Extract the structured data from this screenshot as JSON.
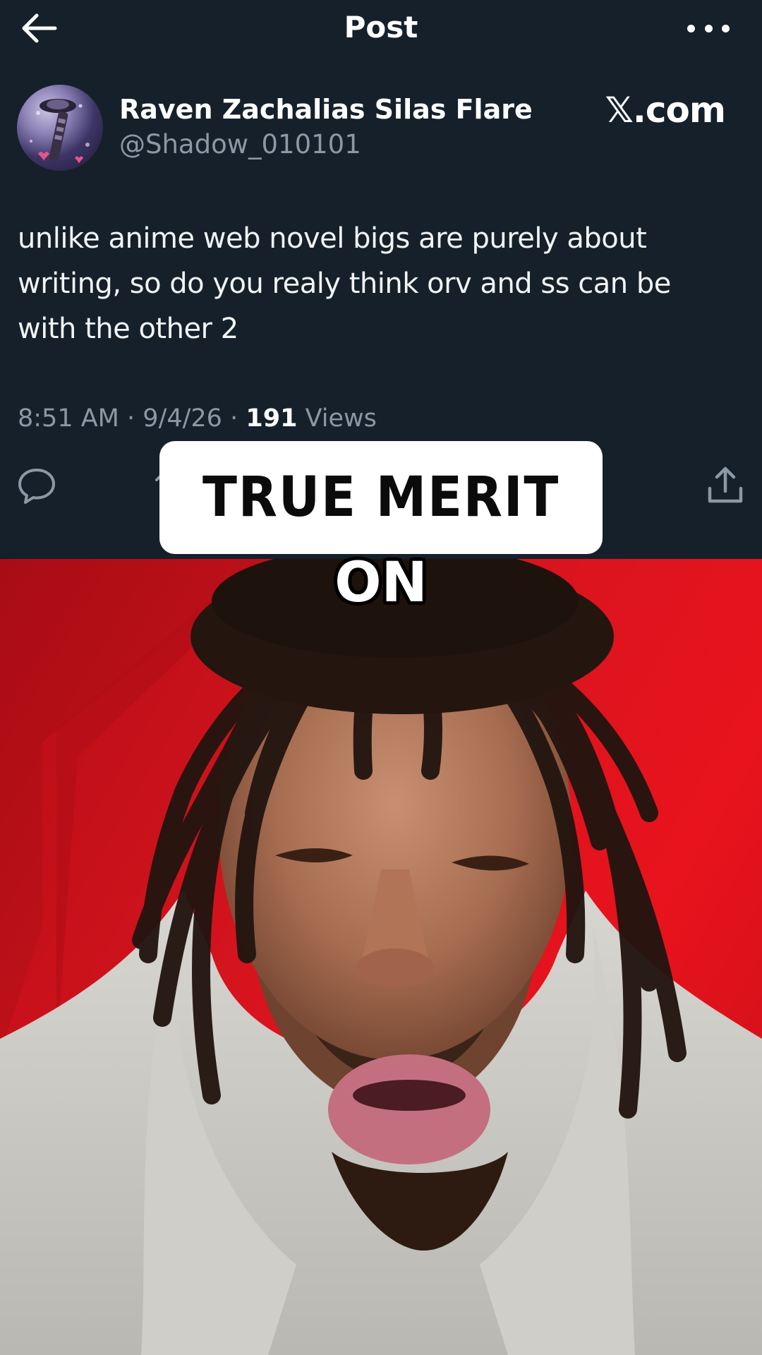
{
  "header": {
    "title": "Post",
    "back_icon": "arrow-left-icon",
    "more_icon": "ellipsis-icon"
  },
  "author": {
    "name": "Raven Zachalias Silas Flare",
    "handle": "@Shadow_010101",
    "avatar": "avatar-image"
  },
  "watermark": "𝕏.com",
  "post": {
    "text": "unlike anime web novel bigs are purely about writing, so do you realy think orv and ss can be with the other 2",
    "time": "8:51 AM",
    "date": "9/4/26",
    "views_count": "191",
    "views_label": "Views",
    "separator": "·"
  },
  "actions": {
    "reply_icon": "reply-icon",
    "retweet_icon": "retweet-icon",
    "share_icon": "share-icon"
  },
  "caption": {
    "line1": "TRUE MERIT",
    "line2": "ON"
  },
  "colors": {
    "panel_bg": "#15202b",
    "secondary_text": "#8b98a5",
    "video_bg_red": "#d6141e"
  }
}
